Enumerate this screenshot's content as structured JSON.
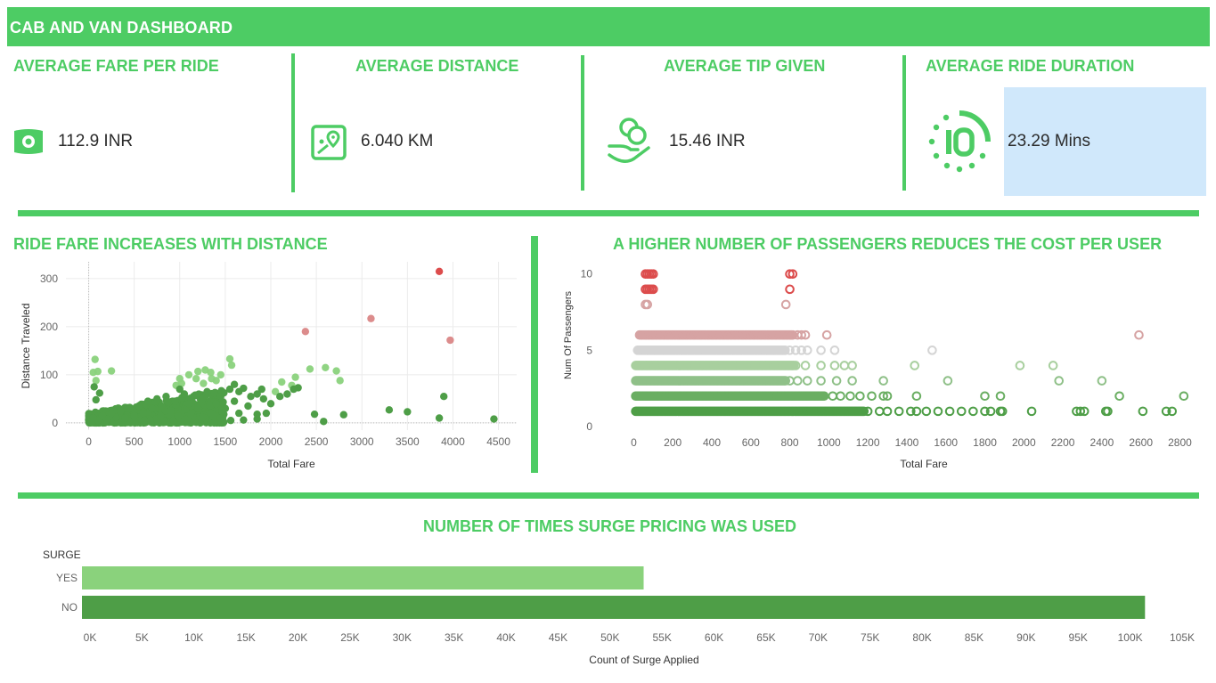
{
  "header": {
    "title": "CAB AND VAN  DASHBOARD"
  },
  "kpis": [
    {
      "title": "AVERAGE FARE PER RIDE",
      "value": "112.9 INR",
      "icon": "cash-icon"
    },
    {
      "title": "AVERAGE DISTANCE",
      "value": "6.040 KM",
      "icon": "map-pin-icon"
    },
    {
      "title": "AVERAGE TIP GIVEN",
      "value": "15.46 INR",
      "icon": "hand-coins-icon"
    },
    {
      "title": "AVERAGE RIDE DURATION",
      "value": "23.29 Mins",
      "icon": "timer-10-icon"
    }
  ],
  "colors": {
    "accent": "#4dcc64",
    "dark_green": "#4e9e47",
    "light_green": "#8ad27c",
    "pale_green": "#a8cf9e",
    "red": "#dc4c4c",
    "pink": "#d6a3a3",
    "grey": "#d4d4d4",
    "highlight": "#d0e8fb"
  },
  "chart_data": [
    {
      "type": "scatter",
      "title": "RIDE FARE INCREASES WITH DISTANCE",
      "xlabel": "Total Fare",
      "ylabel": "Distance Traveled",
      "xlim": [
        -250,
        4700
      ],
      "ylim": [
        -15,
        335
      ],
      "xticks": [
        0,
        500,
        1000,
        1500,
        2000,
        2500,
        3000,
        3500,
        4000,
        4500
      ],
      "yticks": [
        0,
        100,
        200,
        300
      ],
      "grid": true,
      "points": [
        [
          3850,
          315,
          "red"
        ],
        [
          3100,
          217,
          "pink"
        ],
        [
          3970,
          172,
          "pink"
        ],
        [
          2380,
          190,
          "pink"
        ],
        [
          70,
          132,
          "light"
        ],
        [
          50,
          105,
          "light"
        ],
        [
          100,
          107,
          "light"
        ],
        [
          250,
          108,
          "light"
        ],
        [
          80,
          88,
          "light"
        ],
        [
          1550,
          133,
          "light"
        ],
        [
          1570,
          120,
          "light"
        ],
        [
          2430,
          112,
          "light"
        ],
        [
          2600,
          115,
          "light"
        ],
        [
          2720,
          108,
          "light"
        ],
        [
          2760,
          88,
          "light"
        ],
        [
          2270,
          95,
          "light"
        ],
        [
          2120,
          85,
          "light"
        ],
        [
          2230,
          78,
          "light"
        ],
        [
          2050,
          65,
          "light"
        ],
        [
          1340,
          105,
          "light"
        ],
        [
          1280,
          110,
          "light"
        ],
        [
          1200,
          107,
          "light"
        ],
        [
          1100,
          100,
          "light"
        ],
        [
          1400,
          88,
          "light"
        ],
        [
          1260,
          82,
          "light"
        ],
        [
          1180,
          92,
          "light"
        ],
        [
          1000,
          92,
          "light"
        ],
        [
          1450,
          100,
          "light"
        ],
        [
          1350,
          92,
          "light"
        ],
        [
          1020,
          82,
          "light"
        ],
        [
          960,
          78,
          "light"
        ],
        [
          3900,
          55,
          "dark"
        ],
        [
          3850,
          10,
          "dark"
        ],
        [
          4450,
          8,
          "dark"
        ],
        [
          3300,
          27,
          "dark"
        ],
        [
          3500,
          23,
          "dark"
        ],
        [
          2800,
          17,
          "dark"
        ],
        [
          2580,
          3,
          "dark"
        ],
        [
          2480,
          18,
          "dark"
        ],
        [
          2300,
          73,
          "dark"
        ],
        [
          2250,
          70,
          "dark"
        ],
        [
          2180,
          60,
          "dark"
        ],
        [
          1900,
          70,
          "dark"
        ],
        [
          1850,
          60,
          "dark"
        ],
        [
          1780,
          55,
          "dark"
        ],
        [
          1700,
          72,
          "dark"
        ],
        [
          1650,
          65,
          "dark"
        ],
        [
          1550,
          70,
          "dark"
        ],
        [
          1600,
          45,
          "dark"
        ],
        [
          1750,
          35,
          "dark"
        ],
        [
          1850,
          18,
          "dark"
        ],
        [
          1850,
          8,
          "dark"
        ],
        [
          1650,
          20,
          "dark"
        ],
        [
          1700,
          6,
          "dark"
        ],
        [
          1500,
          30,
          "dark"
        ],
        [
          1450,
          55,
          "dark"
        ],
        [
          1400,
          40,
          "dark"
        ],
        [
          1350,
          20,
          "dark"
        ],
        [
          1300,
          65,
          "dark"
        ],
        [
          1250,
          50,
          "dark"
        ],
        [
          1200,
          30,
          "dark"
        ],
        [
          1150,
          55,
          "dark"
        ],
        [
          1100,
          40,
          "dark"
        ],
        [
          1050,
          60,
          "dark"
        ],
        [
          950,
          45,
          "dark"
        ],
        [
          900,
          25,
          "dark"
        ],
        [
          850,
          55,
          "dark"
        ],
        [
          800,
          35,
          "dark"
        ],
        [
          750,
          50,
          "dark"
        ],
        [
          700,
          30,
          "dark"
        ],
        [
          650,
          45,
          "dark"
        ],
        [
          600,
          20,
          "dark"
        ],
        [
          550,
          35,
          "dark"
        ],
        [
          500,
          15,
          "dark"
        ],
        [
          450,
          30,
          "dark"
        ],
        [
          400,
          10,
          "dark"
        ],
        [
          350,
          25,
          "dark"
        ],
        [
          300,
          12,
          "dark"
        ],
        [
          250,
          20,
          "dark"
        ],
        [
          200,
          8,
          "dark"
        ],
        [
          150,
          15,
          "dark"
        ],
        [
          100,
          5,
          "dark"
        ],
        [
          50,
          10,
          "dark"
        ],
        [
          20,
          2,
          "dark"
        ],
        [
          60,
          75,
          "dark"
        ],
        [
          120,
          62,
          "dark"
        ],
        [
          80,
          48,
          "dark"
        ],
        [
          1000,
          70,
          "dark"
        ],
        [
          1250,
          12,
          "dark"
        ],
        [
          1560,
          5,
          "dark"
        ],
        [
          930,
          5,
          "dark"
        ],
        [
          1450,
          10,
          "dark"
        ],
        [
          1120,
          18,
          "dark"
        ],
        [
          1600,
          80,
          "dark"
        ],
        [
          2000,
          40,
          "dark"
        ],
        [
          2100,
          55,
          "dark"
        ],
        [
          1950,
          20,
          "dark"
        ],
        [
          1920,
          50,
          "dark"
        ]
      ],
      "dense_band": {
        "x_range": [
          0,
          1500
        ],
        "y_range": [
          0,
          70
        ]
      }
    },
    {
      "type": "scatter",
      "title": "A HIGHER NUMBER OF PASSENGERS REDUCES THE COST PER USER",
      "xlabel": "Total Fare",
      "ylabel": "Num Of Passengers",
      "xlim": [
        -180,
        2880
      ],
      "ylim": [
        0,
        10.8
      ],
      "xticks": [
        0,
        200,
        400,
        600,
        800,
        1000,
        1200,
        1400,
        1600,
        1800,
        2000,
        2200,
        2400,
        2600,
        2800
      ],
      "yticks": [
        0,
        5,
        10
      ],
      "marker": "open-circle",
      "rows": [
        {
          "y": 10,
          "color": "red",
          "range": [
            60,
            100
          ],
          "extra": [
            800,
            815
          ]
        },
        {
          "y": 9,
          "color": "red",
          "range": [
            60,
            100
          ],
          "extra": [
            800
          ]
        },
        {
          "y": 8,
          "color": "pink",
          "range": [
            60,
            70
          ],
          "extra": [
            780
          ]
        },
        {
          "y": 6,
          "color": "pink",
          "range": [
            30,
            820
          ],
          "extra": [
            840,
            860,
            880,
            990,
            2590
          ]
        },
        {
          "y": 5,
          "color": "grey",
          "range": [
            20,
            780
          ],
          "extra": [
            800,
            830,
            860,
            890,
            960,
            1030,
            1530
          ]
        },
        {
          "y": 4,
          "color": "pale",
          "range": [
            10,
            820
          ],
          "extra": [
            830,
            880,
            960,
            1030,
            1080,
            1120,
            1440,
            1980,
            2150
          ]
        },
        {
          "y": 3,
          "color": "pale2",
          "range": [
            10,
            780
          ],
          "extra": [
            800,
            840,
            890,
            960,
            1040,
            1120,
            1280,
            1610,
            2180,
            2400
          ]
        },
        {
          "y": 2,
          "color": "green",
          "range": [
            10,
            980
          ],
          "extra": [
            1020,
            1060,
            1110,
            1160,
            1220,
            1280,
            1300,
            1450,
            1800,
            1880,
            2490,
            2820
          ]
        },
        {
          "y": 1,
          "color": "dark",
          "range": [
            10,
            1180
          ],
          "extra": [
            1200,
            1260,
            1300,
            1360,
            1420,
            1450,
            1500,
            1560,
            1620,
            1680,
            1740,
            1800,
            1830,
            1880,
            1890,
            2040,
            2270,
            2290,
            2310,
            2420,
            2430,
            2610,
            2730,
            2760
          ]
        }
      ]
    },
    {
      "type": "bar",
      "orientation": "horizontal",
      "title": "NUMBER OF TIMES SURGE PRICING WAS USED",
      "legend_title": "SURGE",
      "categories": [
        "YES",
        "NO"
      ],
      "values": [
        54000,
        102200
      ],
      "xlabel": "Count of Surge Applied",
      "xlim": [
        0,
        105000
      ],
      "xticks": [
        "0K",
        "5K",
        "10K",
        "15K",
        "20K",
        "25K",
        "30K",
        "35K",
        "40K",
        "45K",
        "50K",
        "55K",
        "60K",
        "65K",
        "70K",
        "75K",
        "80K",
        "85K",
        "90K",
        "95K",
        "100K",
        "105K"
      ]
    }
  ]
}
